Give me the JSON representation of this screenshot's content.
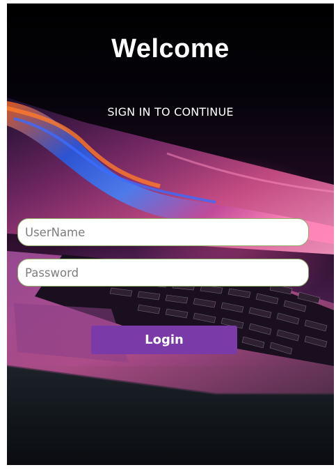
{
  "header": {
    "title": "Welcome",
    "subtitle": "SIGN IN TO CONTINUE"
  },
  "form": {
    "username_placeholder": "UserName",
    "username_value": "",
    "password_placeholder": "Password",
    "password_value": "",
    "login_label": "Login"
  },
  "background": {
    "image": "laptop-keyboard-illustration"
  },
  "colors": {
    "button": "#7a3aa8",
    "field_border": "#8fae6a",
    "title_text": "#ffffff",
    "background_top": "#000000"
  }
}
